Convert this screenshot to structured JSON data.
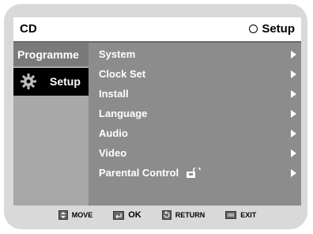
{
  "header": {
    "left_label": "CD",
    "right_label": "Setup"
  },
  "sidebar": {
    "items": [
      {
        "label": "Programme"
      },
      {
        "label": "Setup"
      }
    ]
  },
  "menu": {
    "items": [
      {
        "label": "System"
      },
      {
        "label": "Clock Set"
      },
      {
        "label": "Install"
      },
      {
        "label": "Language"
      },
      {
        "label": "Audio"
      },
      {
        "label": "Video"
      },
      {
        "label": "Parental Control"
      }
    ]
  },
  "footer": {
    "hints": [
      {
        "label": "MOVE",
        "icon": "updown-arrows-icon"
      },
      {
        "label": "OK",
        "icon": "enter-icon"
      },
      {
        "label": "RETURN",
        "icon": "return-icon"
      },
      {
        "label": "EXIT",
        "icon": "exit-icon"
      }
    ]
  },
  "colors": {
    "screen_bg": "#8c8c8c",
    "sidebar_bg": "#a8a8a8",
    "selected_bg": "#000000",
    "frame_bg": "#d9d9d9"
  }
}
